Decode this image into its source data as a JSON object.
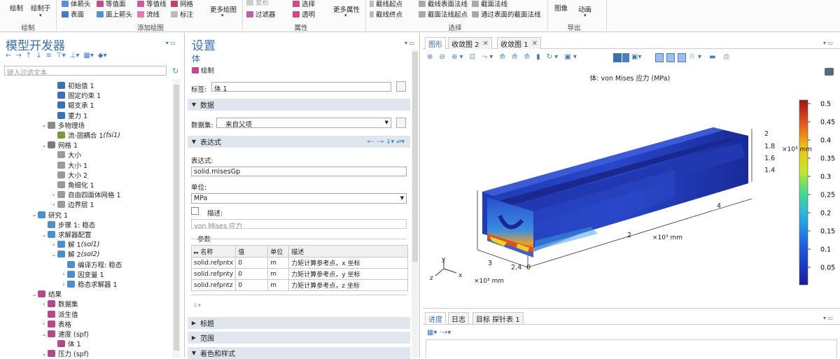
{
  "ribbon": {
    "draw": "绘制",
    "draw_in": "绘制于",
    "add_arrow_body": "体箭头",
    "surface": "表面",
    "contour_a": "等值面",
    "arrow_surface": "面上箭头",
    "isosurface": "等值线",
    "streamline": "流线",
    "mesh": "网格",
    "annotation": "标注",
    "more_plots": "更多绘图",
    "group_add_plot": "添加绘图",
    "deformation": "变形",
    "filter": "过滤器",
    "selection": "选择",
    "transparency": "透明",
    "more_attrs": "更多属性",
    "group_attr": "属性",
    "cutline_start": "截线起点",
    "cutline_end": "截线终点",
    "cutline_surface_normal": "截线表面法线",
    "cutplane_normal_start": "截面法线起点",
    "cutplane_normal": "截面法线",
    "cutplane_through_surface": "通过表面的截面法线",
    "group_select": "选择",
    "image": "图像",
    "animation": "动画",
    "group_export": "导出"
  },
  "model_builder": {
    "title": "模型开发器",
    "filter_placeholder": "键入过滤文本",
    "tree": [
      {
        "label": "初始值 1",
        "italic": "",
        "indent": 4,
        "exp": "",
        "color": "#3c6fb4"
      },
      {
        "label": "固定约束 1",
        "italic": "",
        "indent": 4,
        "exp": "",
        "color": "#3c6fb4"
      },
      {
        "label": "辊支承 1",
        "italic": "",
        "indent": 4,
        "exp": "",
        "color": "#3c6fb4"
      },
      {
        "label": "重力 1",
        "italic": "",
        "indent": 4,
        "exp": "",
        "color": "#3c6fb4"
      },
      {
        "label": "多物理场",
        "italic": "",
        "indent": 3,
        "exp": "⌄",
        "color": "#8a8a8a"
      },
      {
        "label": "流-固耦合 1 ",
        "italic": "(fsi1)",
        "indent": 4,
        "exp": "",
        "color": "#7a9a3a"
      },
      {
        "label": "网格 1",
        "italic": "",
        "indent": 3,
        "exp": "⌄",
        "color": "#7a7a7a"
      },
      {
        "label": "大小",
        "italic": "",
        "indent": 4,
        "exp": "",
        "color": "#9a9a9a"
      },
      {
        "label": "大小 1",
        "italic": "",
        "indent": 4,
        "exp": "",
        "color": "#9a9a9a"
      },
      {
        "label": "大小 2",
        "italic": "",
        "indent": 4,
        "exp": "",
        "color": "#9a9a9a"
      },
      {
        "label": "角细化 1",
        "italic": "",
        "indent": 4,
        "exp": "",
        "color": "#9a9a9a"
      },
      {
        "label": "自由四面体网格 1",
        "italic": "",
        "indent": 4,
        "exp": "›",
        "color": "#9a9a9a"
      },
      {
        "label": "边界层 1",
        "italic": "",
        "indent": 4,
        "exp": "›",
        "color": "#9a9a9a"
      },
      {
        "label": "研究 1",
        "italic": "",
        "indent": 2,
        "exp": "⌄",
        "color": "#4f8fc8"
      },
      {
        "label": "步骤 1: 稳态",
        "italic": "",
        "indent": 3,
        "exp": "",
        "color": "#4f8fc8"
      },
      {
        "label": "求解器配置",
        "italic": "",
        "indent": 3,
        "exp": "⌄",
        "color": "#4f8fc8"
      },
      {
        "label": "解 1 ",
        "italic": "(sol1)",
        "indent": 4,
        "exp": "›",
        "color": "#4f8fc8"
      },
      {
        "label": "解 2 ",
        "italic": "(sol2)",
        "indent": 4,
        "exp": "⌄",
        "color": "#4f8fc8"
      },
      {
        "label": "编译方程: 稳态",
        "italic": "",
        "indent": 5,
        "exp": "",
        "color": "#4f8fc8"
      },
      {
        "label": "因变量 1",
        "italic": "",
        "indent": 5,
        "exp": "›",
        "color": "#4f8fc8"
      },
      {
        "label": "稳态求解器 1",
        "italic": "",
        "indent": 5,
        "exp": "›",
        "color": "#4f8fc8"
      },
      {
        "label": "结果",
        "italic": "",
        "indent": 2,
        "exp": "⌄",
        "color": "#b04a8a"
      },
      {
        "label": "数据集",
        "italic": "",
        "indent": 3,
        "exp": "›",
        "color": "#b04a8a"
      },
      {
        "label": "派生值",
        "italic": "",
        "indent": 3,
        "exp": "",
        "color": "#b04a8a"
      },
      {
        "label": "表格",
        "italic": "",
        "indent": 3,
        "exp": "›",
        "color": "#b04a8a"
      },
      {
        "label": "速度 (spf)",
        "italic": "",
        "indent": 3,
        "exp": "⌄",
        "color": "#b04a8a"
      },
      {
        "label": "体 1",
        "italic": "",
        "indent": 4,
        "exp": "",
        "color": "#b04a8a"
      },
      {
        "label": "压力 (spf)",
        "italic": "",
        "indent": 3,
        "exp": "⌄",
        "color": "#b04a8a"
      }
    ]
  },
  "settings": {
    "title": "设置",
    "subtitle": "体",
    "draw_label": "绘制",
    "tag_label": "标签:",
    "tag_value": "体 1",
    "sec_data": "数据",
    "dataset_label": "数据集:",
    "dataset_value": "来自父项",
    "sec_expr": "表达式",
    "expr_label": "表达式:",
    "expr_value": "solid.misesGp",
    "unit_label": "单位:",
    "unit_value": "MPa",
    "desc_label": "描述:",
    "desc_value": "von Mises 应力",
    "params_label": "参数",
    "params_headers": [
      "名称",
      "值",
      "单位",
      "描述"
    ],
    "params_rows": [
      [
        "solid.refpntx",
        "0",
        "m",
        "力矩计算参考点，x 坐标"
      ],
      [
        "solid.refpnty",
        "0",
        "m",
        "力矩计算参考点，y 坐标"
      ],
      [
        "solid.refpntz",
        "0",
        "m",
        "力矩计算参考点，z 坐标"
      ]
    ],
    "sec_title": "标题",
    "sec_range": "范围",
    "sec_color": "着色和样式"
  },
  "graphics": {
    "tabs": [
      "图形",
      "收敛图 2",
      "收敛图 1"
    ],
    "plot_title": "体: von Mises 应力 (MPa)",
    "colorbar_ticks": [
      "0.5",
      "0.45",
      "0.4",
      "0.35",
      "0.3",
      "0.25",
      "0.2",
      "0.15",
      "0.1",
      "0.05"
    ],
    "axis_z_ticks": [
      "2",
      "1.8",
      "1.6",
      "1.4"
    ],
    "axis_z_unit": "×10³ mm",
    "axis_x_ticks": [
      "4",
      "2"
    ],
    "axis_x_unit": "×10³ mm",
    "axis_y_ticks": [
      "3",
      "2.4",
      "0"
    ],
    "axis_y_unit": "×10³ mm",
    "triad": {
      "x": "x",
      "y": "y",
      "z": "z"
    }
  },
  "bottom": {
    "tabs": [
      "进度",
      "日志",
      "目标 探针表 1"
    ]
  },
  "colors": {
    "accent": "#3a6fb0",
    "section_bg": "#dfe6ee"
  }
}
